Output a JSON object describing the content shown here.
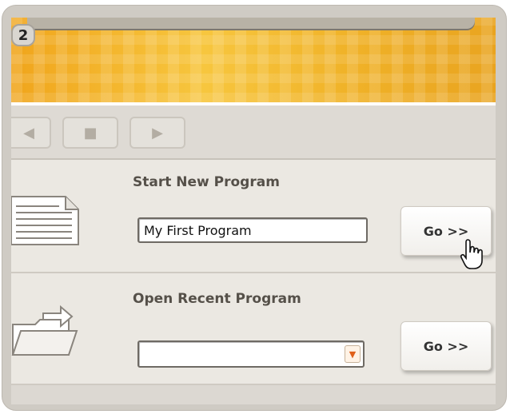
{
  "step_badge": "2",
  "navigation": {
    "back_icon": "back-arrow-icon",
    "stop_icon": "stop-square-icon",
    "play_icon": "play-arrow-icon"
  },
  "start_new": {
    "title": "Start New Program",
    "input_value": "My First Program",
    "go_label": "Go >>",
    "icon": "document-icon"
  },
  "open_recent": {
    "title": "Open Recent Program",
    "selected_value": "",
    "go_label": "Go >>",
    "icon": "folder-open-icon"
  },
  "colors": {
    "banner": "#f2b02a",
    "panel": "#ebe8e2",
    "accent_dropdown": "#e0601a"
  }
}
